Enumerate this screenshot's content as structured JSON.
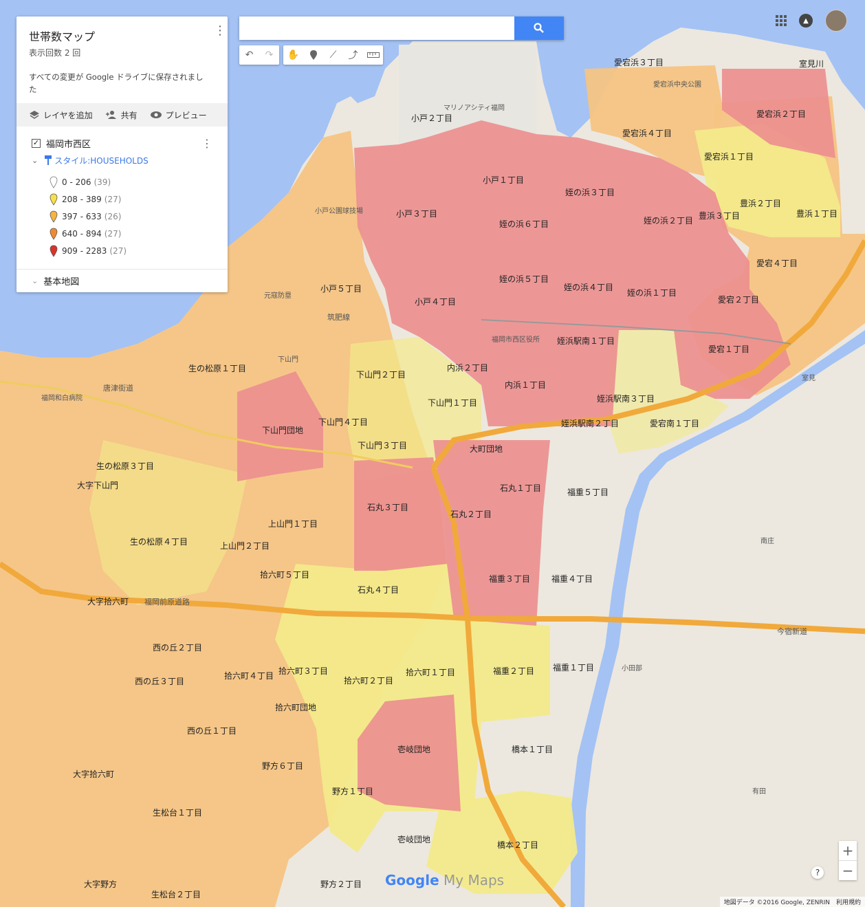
{
  "panel": {
    "title": "世帯数マップ",
    "views": "表示回数 2 回",
    "saved_msg": "すべての変更が Google ドライブに保存されました",
    "add_layer": "レイヤを追加",
    "share": "共有",
    "preview": "プレビュー",
    "layer_name": "福岡市西区",
    "style_label": "スタイル:HOUSEHOLDS",
    "legend": [
      {
        "range": "0 - 206",
        "count": "(39)",
        "color": "#ffffff"
      },
      {
        "range": "208 - 389",
        "count": "(27)",
        "color": "#f7e04b"
      },
      {
        "range": "397 - 633",
        "count": "(26)",
        "color": "#f5b342"
      },
      {
        "range": "640 - 894",
        "count": "(27)",
        "color": "#ef8a33"
      },
      {
        "range": "909 - 2283",
        "count": "(27)",
        "color": "#d9342b"
      }
    ],
    "base_map": "基本地図"
  },
  "search": {
    "placeholder": ""
  },
  "map_labels": {
    "l1": "室見川",
    "l2": "愛宕浜３丁目",
    "l3": "愛宕浜２丁目",
    "l4": "愛宕浜４丁目",
    "l5": "愛宕浜１丁目",
    "l6": "豊浜２丁目",
    "l7": "豊浜３丁目",
    "l8": "豊浜１丁目",
    "l9": "小戸２丁目",
    "l10": "小戸１丁目",
    "l11": "小戸３丁目",
    "l12": "姪の浜３丁目",
    "l13": "姪の浜２丁目",
    "l14": "姪の浜６丁目",
    "l15": "姪の浜５丁目",
    "l16": "姪の浜４丁目",
    "l17": "姪の浜１丁目",
    "l18": "愛宕４丁目",
    "l19": "愛宕２丁目",
    "l20": "愛宕１丁目",
    "l21": "小戸５丁目",
    "l22": "小戸４丁目",
    "l23": "姪浜駅南１丁目",
    "l24": "内浜２丁目",
    "l25": "内浜１丁目",
    "l26": "姪浜駅南３丁目",
    "l27": "姪浜駅南２丁目",
    "l28": "愛宕南１丁目",
    "l29": "下山門２丁目",
    "l30": "下山門１丁目",
    "l31": "下山門４丁目",
    "l32": "下山門団地",
    "l33": "下山門３丁目",
    "l34": "大町団地",
    "l35": "生の松原１丁目",
    "l36": "生の松原３丁目",
    "l37": "大字下山門",
    "l38": "石丸１丁目",
    "l39": "石丸３丁目",
    "l40": "石丸２丁目",
    "l41": "福重５丁目",
    "l42": "上山門１丁目",
    "l43": "上山門２丁目",
    "l44": "生の松原４丁目",
    "l45": "拾六町５丁目",
    "l46": "石丸４丁目",
    "l47": "福重３丁目",
    "l48": "福重４丁目",
    "l49": "大字拾六町",
    "l50": "西の丘２丁目",
    "l51": "西の丘３丁目",
    "l52": "拾六町３丁目",
    "l53": "拾六町４丁目",
    "l54": "拾六町２丁目",
    "l55": "拾六町１丁目",
    "l56": "福重２丁目",
    "l57": "福重１丁目",
    "l58": "拾六町団地",
    "l59": "西の丘１丁目",
    "l60": "壱岐団地",
    "l61": "橋本１丁目",
    "l62": "野方６丁目",
    "l63": "大字拾六町",
    "l64": "野方１丁目",
    "l65": "生松台１丁目",
    "l66": "壱岐団地",
    "l67": "橋本２丁目",
    "l68": "大字野方",
    "l69": "生松台２丁目",
    "l70": "野方２丁目",
    "l71": "元寇防塁",
    "l72": "小戸公園球技場",
    "l73": "唐津街道",
    "l74": "筑肥線",
    "l75": "今宿新道",
    "l76": "福岡前原道路",
    "l77": "福岡和白病院",
    "l78": "下山門",
    "l79": "小田部",
    "l80": "有田",
    "l81": "南庄",
    "l82": "室見",
    "l83": "愛宕浜中央公園",
    "l84": "マリノアシティ福岡",
    "l85": "福岡市西区役所"
  },
  "attribution": "地図データ ©2016 Google, ZENRIN　利用規約",
  "watermark": {
    "google": "Google",
    "mymaps": "My Maps"
  },
  "zoom": {
    "in": "+",
    "out": "−"
  },
  "help": "?"
}
